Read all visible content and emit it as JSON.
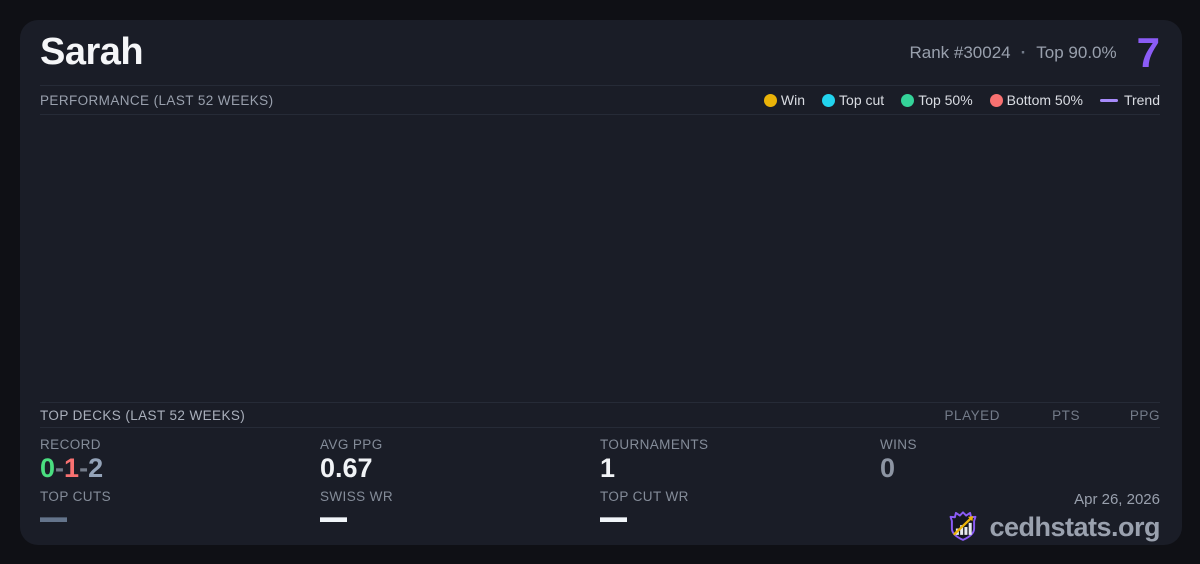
{
  "header": {
    "player_name": "Sarah",
    "rank": "Rank #30024",
    "separator": "·",
    "top_percent": "Top 90.0%",
    "points": "7"
  },
  "performance": {
    "title": "PERFORMANCE (LAST 52 WEEKS)",
    "legend": {
      "win": {
        "label": "Win",
        "color": "#eab308"
      },
      "top_cut": {
        "label": "Top cut",
        "color": "#22d3ee"
      },
      "top_50": {
        "label": "Top 50%",
        "color": "#34d399"
      },
      "bottom_50": {
        "label": "Bottom 50%",
        "color": "#f87171"
      },
      "trend": {
        "label": "Trend",
        "color": "#a78bfa"
      }
    },
    "chart_points": []
  },
  "top_decks": {
    "title": "TOP DECKS (LAST 52 WEEKS)",
    "columns": {
      "played": "PLAYED",
      "pts": "PTS",
      "ppg": "PPG"
    },
    "rows": []
  },
  "stats": {
    "record": {
      "label": "RECORD",
      "wins": "0",
      "losses": "1",
      "draws": "2",
      "separator": "-"
    },
    "avg_ppg": {
      "label": "AVG PPG",
      "value": "0.67"
    },
    "tournaments": {
      "label": "TOURNAMENTS",
      "value": "1"
    },
    "wins": {
      "label": "WINS",
      "value": "0"
    },
    "top_cuts": {
      "label": "TOP CUTS",
      "value": "—"
    },
    "swiss_wr": {
      "label": "SWISS WR",
      "value": "—"
    },
    "top_cut_wr": {
      "label": "TOP CUT WR",
      "value": "—"
    }
  },
  "footer": {
    "date": "Apr 26, 2026",
    "brand": "cedhstats.org"
  },
  "colors": {
    "accent_purple": "#8b5cf6",
    "win_green": "#4ade80",
    "loss_red": "#f87171",
    "neutral_gray": "#94a3b8",
    "card_bg": "#1a1d27",
    "page_bg": "#0f1015"
  }
}
